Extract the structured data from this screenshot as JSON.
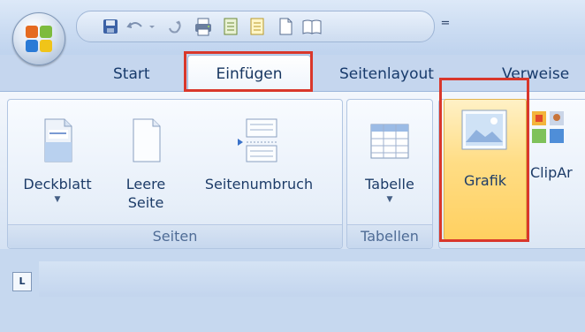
{
  "quick_access": {
    "icons": [
      "save-icon",
      "undo-icon",
      "redo-icon",
      "print-icon",
      "document-icon",
      "document-yellow-icon",
      "new-document-icon",
      "open-book-icon"
    ],
    "customize_symbol": "="
  },
  "tabs": [
    {
      "label": "Start"
    },
    {
      "label": "Einfügen"
    },
    {
      "label": "Seitenlayout"
    },
    {
      "label": "Verweise"
    }
  ],
  "ribbon": {
    "groups": {
      "seiten": {
        "label": "Seiten",
        "buttons": {
          "deckblatt": {
            "label": "Deckblatt"
          },
          "leere_seite": {
            "line1": "Leere",
            "line2": "Seite"
          },
          "seitenumbruch": {
            "label": "Seitenumbruch"
          }
        }
      },
      "tabellen": {
        "label": "Tabellen",
        "buttons": {
          "tabelle": {
            "label": "Tabelle"
          }
        }
      },
      "illustrationen": {
        "buttons": {
          "grafik": {
            "label": "Grafik"
          },
          "clipart": {
            "label": "ClipAr"
          }
        }
      }
    }
  },
  "ruler": {
    "tab_selector": "L"
  },
  "colors": {
    "highlight": "#d9372b",
    "hover_gradient_top": "#fff1c6",
    "hover_gradient_bottom": "#ffd060",
    "tab_text": "#173a6b",
    "ribbon_bg": "#e2ebf7"
  }
}
